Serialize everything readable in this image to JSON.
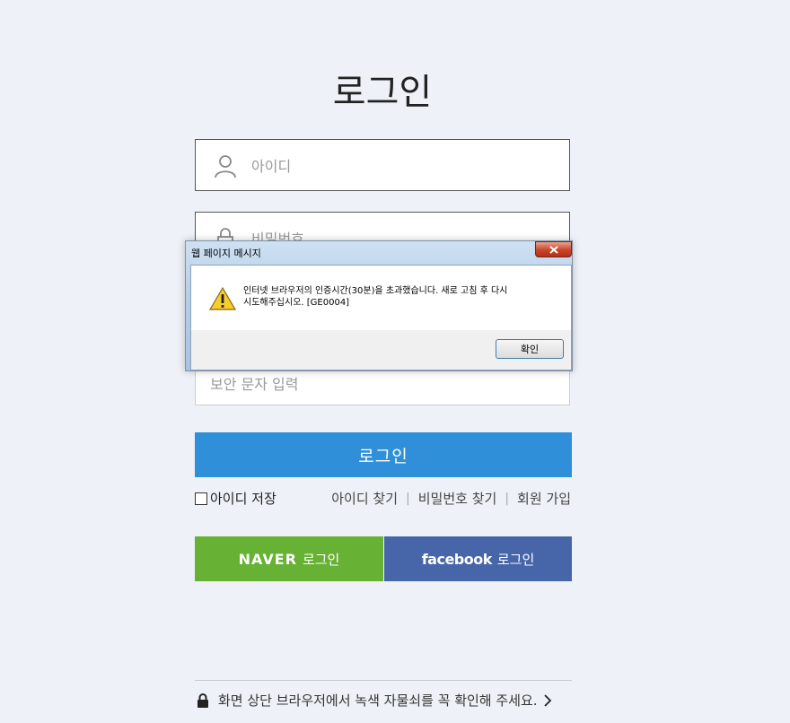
{
  "page": {
    "title": "로그인"
  },
  "form": {
    "id_placeholder": "아이디",
    "password_placeholder": "비밀번호",
    "captcha_placeholder": "보안 문자 입력",
    "login_button": "로그인",
    "save_id_label": "아이디 저장"
  },
  "links": {
    "find_id": "아이디 찾기",
    "find_password": "비밀번호 찾기",
    "signup": "회원 가입",
    "separator": "|"
  },
  "social": {
    "naver_brand": "NAVER",
    "naver_label": "로그인",
    "facebook_brand": "facebook",
    "facebook_label": "로그인"
  },
  "footer": {
    "notice": "화면 상단 브라우저에서 녹색 자물쇠를 꼭 확인해 주세요."
  },
  "dialog": {
    "title": "웹 페이지 메시지",
    "message_line1": "인터넷 브라우저의 인증시간(30분)을 초과했습니다. 새로 고침 후 다시",
    "message_line2": "시도해주십시오. [GE0004]",
    "ok_button": "확인",
    "icon": "warning-icon"
  },
  "colors": {
    "login_button": "#2f8fd8",
    "naver": "#67b234",
    "facebook": "#4766a9",
    "background": "#eef2f8"
  }
}
